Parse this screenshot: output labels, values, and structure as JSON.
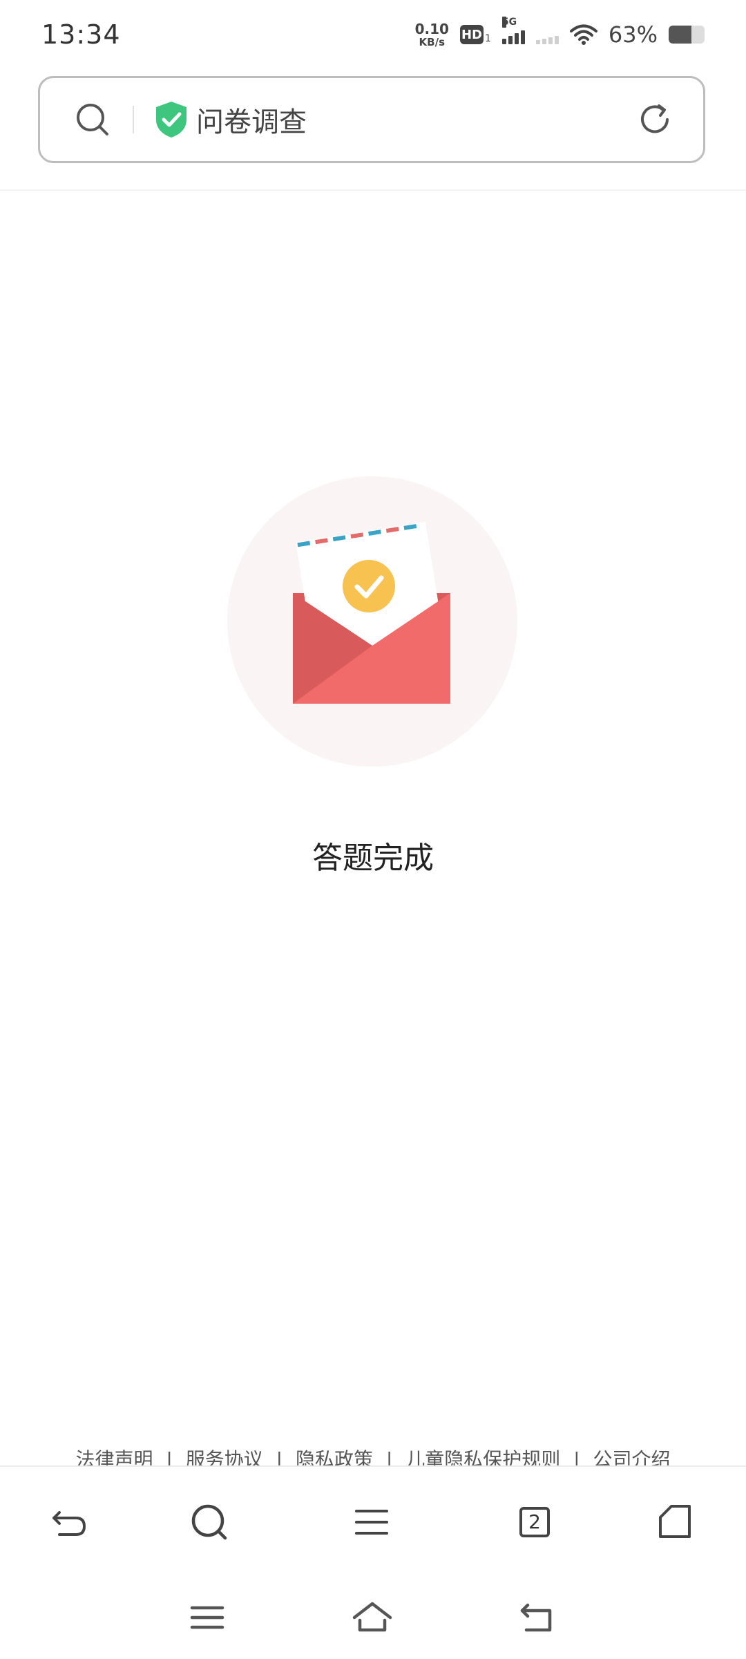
{
  "status_bar": {
    "time": "13:34",
    "net_speed_value": "0.10",
    "net_speed_unit": "KB/s",
    "hd_label": "HD",
    "hd_sub": "1",
    "network_label": "5G",
    "battery_percent": "63%",
    "battery_level": 0.63
  },
  "url_bar": {
    "title": "问卷调查",
    "shield_color": "#3ec67e"
  },
  "content": {
    "completion_text": "答题完成",
    "colors": {
      "circle_bg": "#faf4f4",
      "envelope": "#f26b6b",
      "envelope_dark": "#d95a5a",
      "check_circle": "#f7c250",
      "stripe_blue": "#3aa3c6",
      "stripe_red": "#e56b6b"
    }
  },
  "footer": {
    "links": [
      "法律声明",
      "服务协议",
      "隐私政策",
      "儿童隐私保护规则",
      "公司介绍"
    ],
    "separator": "|"
  },
  "toolbar": {
    "tabs_count": "2",
    "buttons": [
      "back-icon",
      "search-icon",
      "menu-icon",
      "tabs-icon",
      "home-icon"
    ]
  },
  "system_nav": {
    "buttons": [
      "recents-icon",
      "home-icon",
      "back-icon"
    ]
  }
}
